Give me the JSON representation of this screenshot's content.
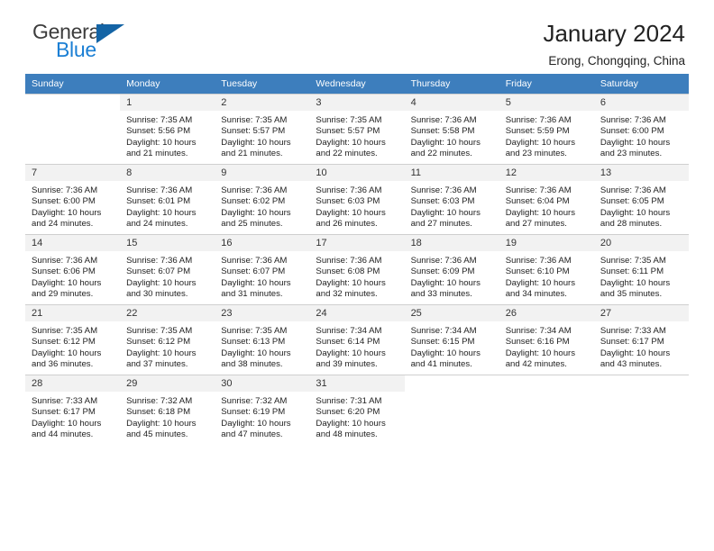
{
  "brand": {
    "name_top": "General",
    "name_bottom": "Blue",
    "flag_color": "#1464a5",
    "blue_color": "#1b7fd4"
  },
  "header": {
    "title": "January 2024",
    "subtitle": "Erong, Chongqing, China"
  },
  "theme": {
    "header_row_bg": "#3d7ebd",
    "daynum_bg": "#f2f2f2",
    "grid_line": "#cfcfcf"
  },
  "weekday_headers": [
    "Sunday",
    "Monday",
    "Tuesday",
    "Wednesday",
    "Thursday",
    "Friday",
    "Saturday"
  ],
  "weeks": [
    [
      {
        "day": "",
        "sunrise": "",
        "sunset": "",
        "daylight1": "",
        "daylight2": ""
      },
      {
        "day": "1",
        "sunrise": "Sunrise: 7:35 AM",
        "sunset": "Sunset: 5:56 PM",
        "daylight1": "Daylight: 10 hours",
        "daylight2": "and 21 minutes."
      },
      {
        "day": "2",
        "sunrise": "Sunrise: 7:35 AM",
        "sunset": "Sunset: 5:57 PM",
        "daylight1": "Daylight: 10 hours",
        "daylight2": "and 21 minutes."
      },
      {
        "day": "3",
        "sunrise": "Sunrise: 7:35 AM",
        "sunset": "Sunset: 5:57 PM",
        "daylight1": "Daylight: 10 hours",
        "daylight2": "and 22 minutes."
      },
      {
        "day": "4",
        "sunrise": "Sunrise: 7:36 AM",
        "sunset": "Sunset: 5:58 PM",
        "daylight1": "Daylight: 10 hours",
        "daylight2": "and 22 minutes."
      },
      {
        "day": "5",
        "sunrise": "Sunrise: 7:36 AM",
        "sunset": "Sunset: 5:59 PM",
        "daylight1": "Daylight: 10 hours",
        "daylight2": "and 23 minutes."
      },
      {
        "day": "6",
        "sunrise": "Sunrise: 7:36 AM",
        "sunset": "Sunset: 6:00 PM",
        "daylight1": "Daylight: 10 hours",
        "daylight2": "and 23 minutes."
      }
    ],
    [
      {
        "day": "7",
        "sunrise": "Sunrise: 7:36 AM",
        "sunset": "Sunset: 6:00 PM",
        "daylight1": "Daylight: 10 hours",
        "daylight2": "and 24 minutes."
      },
      {
        "day": "8",
        "sunrise": "Sunrise: 7:36 AM",
        "sunset": "Sunset: 6:01 PM",
        "daylight1": "Daylight: 10 hours",
        "daylight2": "and 24 minutes."
      },
      {
        "day": "9",
        "sunrise": "Sunrise: 7:36 AM",
        "sunset": "Sunset: 6:02 PM",
        "daylight1": "Daylight: 10 hours",
        "daylight2": "and 25 minutes."
      },
      {
        "day": "10",
        "sunrise": "Sunrise: 7:36 AM",
        "sunset": "Sunset: 6:03 PM",
        "daylight1": "Daylight: 10 hours",
        "daylight2": "and 26 minutes."
      },
      {
        "day": "11",
        "sunrise": "Sunrise: 7:36 AM",
        "sunset": "Sunset: 6:03 PM",
        "daylight1": "Daylight: 10 hours",
        "daylight2": "and 27 minutes."
      },
      {
        "day": "12",
        "sunrise": "Sunrise: 7:36 AM",
        "sunset": "Sunset: 6:04 PM",
        "daylight1": "Daylight: 10 hours",
        "daylight2": "and 27 minutes."
      },
      {
        "day": "13",
        "sunrise": "Sunrise: 7:36 AM",
        "sunset": "Sunset: 6:05 PM",
        "daylight1": "Daylight: 10 hours",
        "daylight2": "and 28 minutes."
      }
    ],
    [
      {
        "day": "14",
        "sunrise": "Sunrise: 7:36 AM",
        "sunset": "Sunset: 6:06 PM",
        "daylight1": "Daylight: 10 hours",
        "daylight2": "and 29 minutes."
      },
      {
        "day": "15",
        "sunrise": "Sunrise: 7:36 AM",
        "sunset": "Sunset: 6:07 PM",
        "daylight1": "Daylight: 10 hours",
        "daylight2": "and 30 minutes."
      },
      {
        "day": "16",
        "sunrise": "Sunrise: 7:36 AM",
        "sunset": "Sunset: 6:07 PM",
        "daylight1": "Daylight: 10 hours",
        "daylight2": "and 31 minutes."
      },
      {
        "day": "17",
        "sunrise": "Sunrise: 7:36 AM",
        "sunset": "Sunset: 6:08 PM",
        "daylight1": "Daylight: 10 hours",
        "daylight2": "and 32 minutes."
      },
      {
        "day": "18",
        "sunrise": "Sunrise: 7:36 AM",
        "sunset": "Sunset: 6:09 PM",
        "daylight1": "Daylight: 10 hours",
        "daylight2": "and 33 minutes."
      },
      {
        "day": "19",
        "sunrise": "Sunrise: 7:36 AM",
        "sunset": "Sunset: 6:10 PM",
        "daylight1": "Daylight: 10 hours",
        "daylight2": "and 34 minutes."
      },
      {
        "day": "20",
        "sunrise": "Sunrise: 7:35 AM",
        "sunset": "Sunset: 6:11 PM",
        "daylight1": "Daylight: 10 hours",
        "daylight2": "and 35 minutes."
      }
    ],
    [
      {
        "day": "21",
        "sunrise": "Sunrise: 7:35 AM",
        "sunset": "Sunset: 6:12 PM",
        "daylight1": "Daylight: 10 hours",
        "daylight2": "and 36 minutes."
      },
      {
        "day": "22",
        "sunrise": "Sunrise: 7:35 AM",
        "sunset": "Sunset: 6:12 PM",
        "daylight1": "Daylight: 10 hours",
        "daylight2": "and 37 minutes."
      },
      {
        "day": "23",
        "sunrise": "Sunrise: 7:35 AM",
        "sunset": "Sunset: 6:13 PM",
        "daylight1": "Daylight: 10 hours",
        "daylight2": "and 38 minutes."
      },
      {
        "day": "24",
        "sunrise": "Sunrise: 7:34 AM",
        "sunset": "Sunset: 6:14 PM",
        "daylight1": "Daylight: 10 hours",
        "daylight2": "and 39 minutes."
      },
      {
        "day": "25",
        "sunrise": "Sunrise: 7:34 AM",
        "sunset": "Sunset: 6:15 PM",
        "daylight1": "Daylight: 10 hours",
        "daylight2": "and 41 minutes."
      },
      {
        "day": "26",
        "sunrise": "Sunrise: 7:34 AM",
        "sunset": "Sunset: 6:16 PM",
        "daylight1": "Daylight: 10 hours",
        "daylight2": "and 42 minutes."
      },
      {
        "day": "27",
        "sunrise": "Sunrise: 7:33 AM",
        "sunset": "Sunset: 6:17 PM",
        "daylight1": "Daylight: 10 hours",
        "daylight2": "and 43 minutes."
      }
    ],
    [
      {
        "day": "28",
        "sunrise": "Sunrise: 7:33 AM",
        "sunset": "Sunset: 6:17 PM",
        "daylight1": "Daylight: 10 hours",
        "daylight2": "and 44 minutes."
      },
      {
        "day": "29",
        "sunrise": "Sunrise: 7:32 AM",
        "sunset": "Sunset: 6:18 PM",
        "daylight1": "Daylight: 10 hours",
        "daylight2": "and 45 minutes."
      },
      {
        "day": "30",
        "sunrise": "Sunrise: 7:32 AM",
        "sunset": "Sunset: 6:19 PM",
        "daylight1": "Daylight: 10 hours",
        "daylight2": "and 47 minutes."
      },
      {
        "day": "31",
        "sunrise": "Sunrise: 7:31 AM",
        "sunset": "Sunset: 6:20 PM",
        "daylight1": "Daylight: 10 hours",
        "daylight2": "and 48 minutes."
      },
      {
        "day": "",
        "sunrise": "",
        "sunset": "",
        "daylight1": "",
        "daylight2": ""
      },
      {
        "day": "",
        "sunrise": "",
        "sunset": "",
        "daylight1": "",
        "daylight2": ""
      },
      {
        "day": "",
        "sunrise": "",
        "sunset": "",
        "daylight1": "",
        "daylight2": ""
      }
    ]
  ]
}
